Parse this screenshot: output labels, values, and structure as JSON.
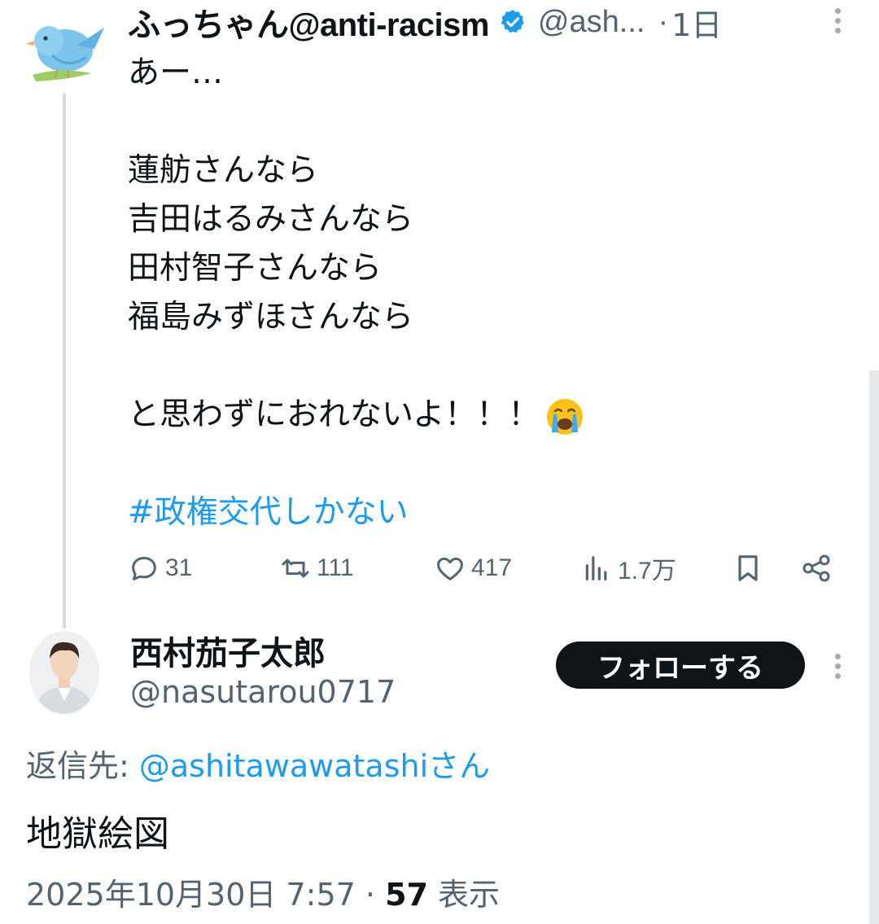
{
  "tweet": {
    "author_name": "ふっちゃん@anti-racism",
    "author_handle": "@ash...",
    "separator": "·",
    "time": "1日",
    "lines": [
      "あー…",
      "",
      "蓮舫さんなら",
      "吉田はるみさんなら",
      "田村智子さんなら",
      "福島みずほさんなら",
      "",
      "と思わずにおれないよ！！！"
    ],
    "hashtag": "#政権交代しかない",
    "emoji": "crying-face-emoji",
    "actions": {
      "replies": "31",
      "retweets": "111",
      "likes": "417",
      "views": "1.7万"
    }
  },
  "reply": {
    "author_name": "西村茄子太郎",
    "author_handle": "@nasutarou0717",
    "follow_label": "フォローする",
    "reply_to_label": "返信先: ",
    "reply_to_mention": "@ashitawawatashiさん",
    "text": "地獄絵図",
    "timestamp": "2025年10月30日 7:57 · ",
    "views_count": "57",
    "views_label": " 表示"
  },
  "icons": [
    "bird-avatar",
    "verified-badge-icon",
    "more-icon",
    "reply-icon",
    "retweet-icon",
    "like-icon",
    "views-icon",
    "bookmark-icon",
    "share-icon"
  ],
  "colors": {
    "accent": "#1d9bf0",
    "muted": "#536471",
    "text": "#0f1419",
    "thread_line": "#d7dbdf"
  }
}
